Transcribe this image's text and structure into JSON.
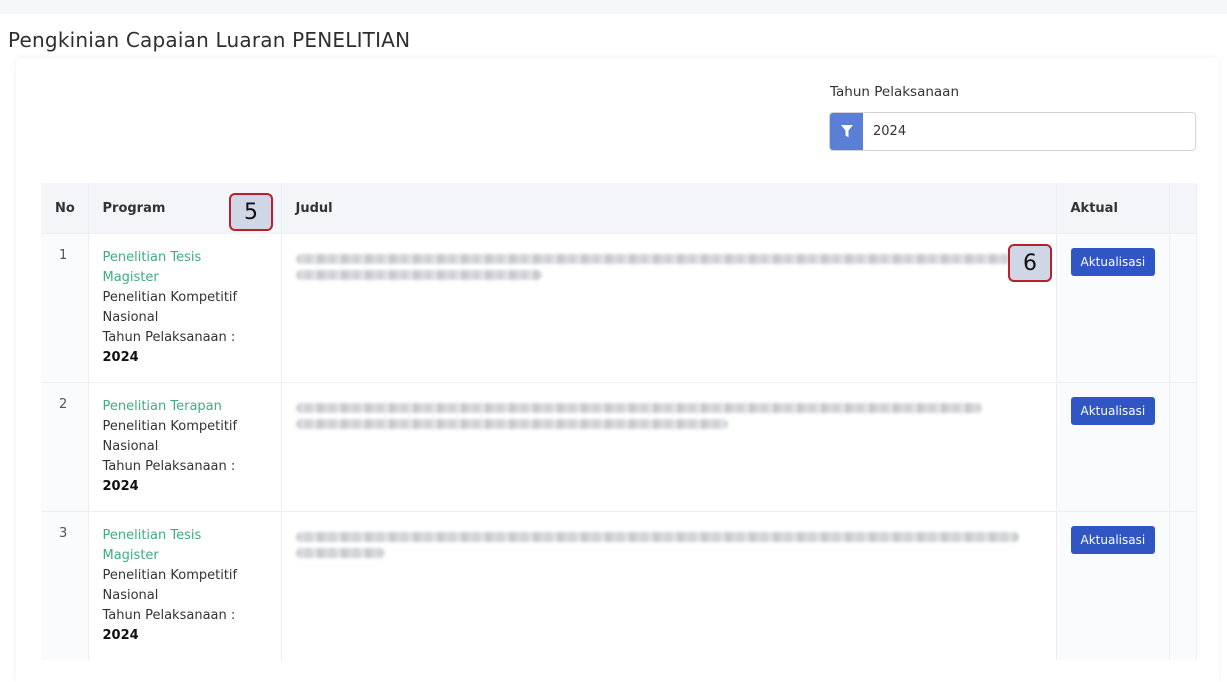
{
  "page": {
    "title": "Pengkinian Capaian Luaran PENELITIAN"
  },
  "filter": {
    "label": "Tahun Pelaksanaan",
    "value": "2024",
    "icon": "filter-icon",
    "button_color": "#5b7fd6"
  },
  "table": {
    "headers": {
      "no": "No",
      "program": "Program",
      "judul": "Judul",
      "aktual": "Aktual"
    },
    "rows": [
      {
        "no": "1",
        "program_name_line1": "Penelitian Tesis",
        "program_name_line2": "Magister",
        "scheme_line1": "Penelitian Kompetitif",
        "scheme_line2": "Nasional",
        "year_label": "Tahun Pelaksanaan :",
        "year_value": "2024",
        "action_label": "Aktualisasi"
      },
      {
        "no": "2",
        "program_name_line1": "Penelitian Terapan",
        "program_name_line2": "",
        "scheme_line1": "Penelitian Kompetitif",
        "scheme_line2": "Nasional",
        "year_label": "Tahun Pelaksanaan :",
        "year_value": "2024",
        "action_label": "Aktualisasi"
      },
      {
        "no": "3",
        "program_name_line1": "Penelitian Tesis",
        "program_name_line2": "Magister",
        "scheme_line1": "Penelitian Kompetitif",
        "scheme_line2": "Nasional",
        "year_label": "Tahun Pelaksanaan :",
        "year_value": "2024",
        "action_label": "Aktualisasi"
      }
    ]
  },
  "annotations": {
    "badge_program": "5",
    "badge_action": "6"
  },
  "colors": {
    "program_link": "#3fae7e",
    "action_button": "#2f56c2",
    "badge_border": "#b8202a"
  }
}
